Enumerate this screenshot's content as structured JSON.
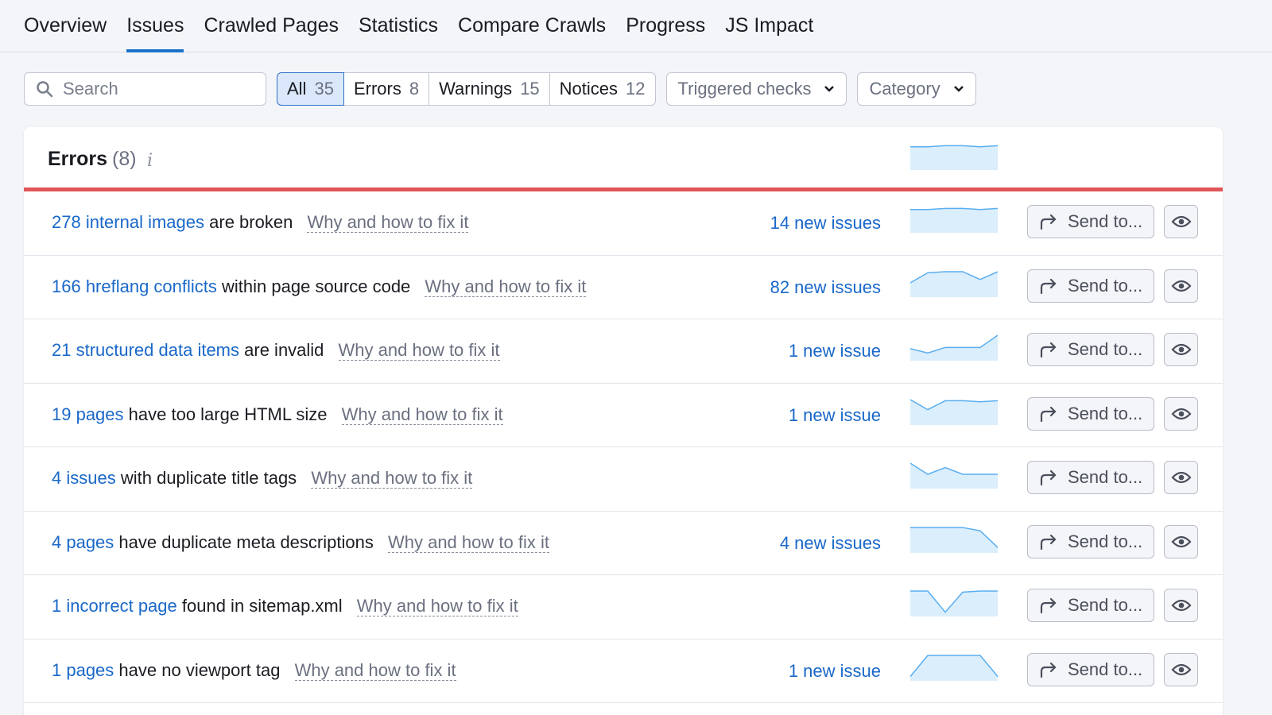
{
  "tabs": [
    "Overview",
    "Issues",
    "Crawled Pages",
    "Statistics",
    "Compare Crawls",
    "Progress",
    "JS Impact"
  ],
  "active_tab": "Issues",
  "search": {
    "placeholder": "Search"
  },
  "filters": [
    {
      "label": "All",
      "count": "35",
      "active": true
    },
    {
      "label": "Errors",
      "count": "8",
      "active": false
    },
    {
      "label": "Warnings",
      "count": "15",
      "active": false
    },
    {
      "label": "Notices",
      "count": "12",
      "active": false
    }
  ],
  "dropdowns": {
    "triggered": "Triggered checks",
    "category": "Category"
  },
  "panel": {
    "title": "Errors",
    "count": "(8)",
    "info": "i"
  },
  "send_label": "Send to...",
  "fix_label": "Why and how to fix it",
  "colors": {
    "accent": "#1a68c9",
    "error_bar": "#e05659",
    "spark_fill": "#dbeefc",
    "spark_line": "#5aaef0"
  },
  "header_trend": [
    0.1,
    0.1,
    0.05,
    0.05,
    0.1,
    0.05
  ],
  "rows": [
    {
      "link": "278 internal images",
      "text": "are broken",
      "new": "14 new issues",
      "trend": [
        0.1,
        0.1,
        0.05,
        0.05,
        0.1,
        0.05
      ]
    },
    {
      "link": "166 hreflang conflicts",
      "text": "within page source code",
      "new": "82 new issues",
      "trend": [
        0.5,
        0.05,
        0.0,
        0.0,
        0.35,
        0.0
      ]
    },
    {
      "link": "21 structured data items",
      "text": "are invalid",
      "new": "1 new issue",
      "trend": [
        0.6,
        0.8,
        0.55,
        0.55,
        0.55,
        0.0
      ]
    },
    {
      "link": "19 pages",
      "text": "have too large HTML size",
      "new": "1 new issue",
      "trend": [
        0.0,
        0.45,
        0.05,
        0.05,
        0.1,
        0.05
      ]
    },
    {
      "link": "4 issues",
      "text": "with duplicate title tags",
      "new": "",
      "trend": [
        0.0,
        0.5,
        0.2,
        0.5,
        0.5,
        0.5
      ]
    },
    {
      "link": "4 pages",
      "text": "have duplicate meta descriptions",
      "new": "4 new issues",
      "trend": [
        0.0,
        0.0,
        0.0,
        0.0,
        0.15,
        0.9
      ]
    },
    {
      "link": "1 incorrect page",
      "text": "found in sitemap.xml",
      "new": "",
      "trend": [
        0.0,
        0.0,
        0.95,
        0.05,
        0.0,
        0.0
      ]
    },
    {
      "link": "1 pages",
      "text": "have no viewport tag",
      "new": "1 new issue",
      "trend": [
        0.95,
        0.0,
        0.0,
        0.0,
        0.0,
        0.95
      ]
    }
  ]
}
